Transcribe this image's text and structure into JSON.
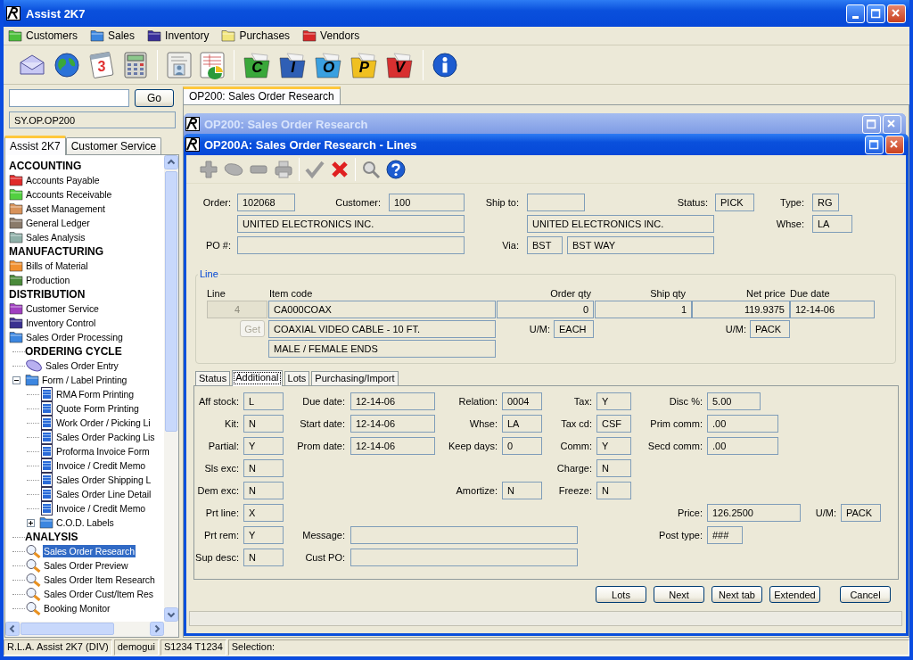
{
  "window": {
    "title": "Assist 2K7"
  },
  "menu": [
    {
      "label": "Customers",
      "color": "#4cbf3c"
    },
    {
      "label": "Sales",
      "color": "#3c86e0"
    },
    {
      "label": "Inventory",
      "color": "#3a2f9a"
    },
    {
      "label": "Purchases",
      "color": "#f2e67c"
    },
    {
      "label": "Vendors",
      "color": "#d82828"
    }
  ],
  "toolbar": {
    "calendar_day": "3",
    "folders": [
      {
        "letter": "C",
        "color": "#3aa83a"
      },
      {
        "letter": "I",
        "color": "#2f5fb5"
      },
      {
        "letter": "O",
        "color": "#3aa0e0"
      },
      {
        "letter": "P",
        "color": "#f0c020"
      },
      {
        "letter": "V",
        "color": "#d83030"
      }
    ]
  },
  "quick_search": {
    "button": "Go"
  },
  "program_path": "SY.OP.OP200",
  "nav_tabs": [
    {
      "label": "Assist 2K7",
      "selected": true
    },
    {
      "label": "Customer Service",
      "selected": false
    }
  ],
  "tree": [
    {
      "kind": "heading",
      "label": "ACCOUNTING",
      "selected": false
    },
    {
      "kind": "folder",
      "label": "Accounts Payable",
      "color": "#e02a2a",
      "selected": false
    },
    {
      "kind": "folder",
      "label": "Accounts Receivable",
      "color": "#52d040",
      "selected": false
    },
    {
      "kind": "folder",
      "label": "Asset Management",
      "color": "#d8925a",
      "selected": false
    },
    {
      "kind": "folder",
      "label": "General Ledger",
      "color": "#8a7a6a",
      "selected": false
    },
    {
      "kind": "folder",
      "label": "Sales Analysis",
      "color": "#8fb0a8",
      "selected": false
    },
    {
      "kind": "heading",
      "label": "MANUFACTURING",
      "selected": false
    },
    {
      "kind": "folder",
      "label": "Bills of Material",
      "color": "#f09030",
      "selected": false
    },
    {
      "kind": "folder",
      "label": "Production",
      "color": "#4a8a3a",
      "selected": false
    },
    {
      "kind": "heading",
      "label": "DISTRIBUTION",
      "selected": false
    },
    {
      "kind": "folder",
      "label": "Customer Service",
      "color": "#a040c0",
      "selected": false
    },
    {
      "kind": "folder",
      "label": "Inventory Control",
      "color": "#3a3090",
      "selected": false
    },
    {
      "kind": "folder",
      "label": "Sales Order Processing",
      "color": "#3c86e0",
      "selected": false,
      "children": [
        {
          "kind": "heading",
          "label": "ORDERING CYCLE",
          "selected": false
        },
        {
          "kind": "entry",
          "label": "Sales Order Entry",
          "selected": false
        },
        {
          "kind": "folder",
          "label": "Form / Label Printing",
          "color": "#3c86e0",
          "selected": false,
          "expanded": true,
          "children": [
            {
              "kind": "form",
              "label": "RMA Form Printing",
              "selected": false
            },
            {
              "kind": "form",
              "label": "Quote Form Printing",
              "selected": false
            },
            {
              "kind": "form",
              "label": "Work Order / Picking Li",
              "selected": false
            },
            {
              "kind": "form",
              "label": "Sales Order Packing Lis",
              "selected": false
            },
            {
              "kind": "form",
              "label": "Proforma Invoice Form",
              "selected": false
            },
            {
              "kind": "form",
              "label": "Invoice / Credit Memo",
              "selected": false
            },
            {
              "kind": "form",
              "label": "Sales Order Shipping L",
              "selected": false
            },
            {
              "kind": "form",
              "label": "Sales Order Line Detail",
              "selected": false
            },
            {
              "kind": "form",
              "label": "Invoice / Credit Memo",
              "selected": false
            },
            {
              "kind": "folder",
              "label": "C.O.D. Labels",
              "color": "#3c86e0",
              "selected": false,
              "expanded": false
            }
          ]
        },
        {
          "kind": "heading",
          "label": "ANALYSIS",
          "selected": false
        },
        {
          "kind": "inquiry",
          "label": "Sales Order Research",
          "selected": true
        },
        {
          "kind": "inquiry",
          "label": "Sales Order Preview",
          "selected": false
        },
        {
          "kind": "inquiry",
          "label": "Sales Order Item Research",
          "selected": false
        },
        {
          "kind": "inquiry",
          "label": "Sales Order Cust/Item Res",
          "selected": false
        },
        {
          "kind": "inquiry",
          "label": "Booking Monitor",
          "selected": false
        }
      ]
    }
  ],
  "document_tab": {
    "label": "OP200: Sales Order Research",
    "selected": true
  },
  "back_window": {
    "title": "OP200: Sales Order Research"
  },
  "lines_window": {
    "title": "OP200A: Sales Order Research - Lines",
    "header_fields": [
      {
        "label": "Order:",
        "value": "102068"
      },
      {
        "label": "Customer:",
        "value": "100"
      },
      {
        "label": "Ship to:"
      },
      {
        "label": "Status:",
        "value": "PICK"
      },
      {
        "label": "Type:",
        "value": "RG"
      },
      {
        "value": "UNITED ELECTRONICS INC."
      },
      {
        "value": "UNITED ELECTRONICS INC."
      },
      {
        "label": "Whse:",
        "value": "LA"
      },
      {
        "label": "PO #:"
      },
      {
        "label": "Via:",
        "value": "BST"
      },
      {
        "value": "BST WAY"
      }
    ],
    "line": {
      "legend": "Line",
      "columns": [
        "Line",
        "Item code",
        "Order qty",
        "Ship qty",
        "Net price",
        "Due date"
      ],
      "values": [
        {
          "value": "4",
          "disabled": true
        },
        {
          "value": "CA000COAX",
          "disabled": false
        },
        {
          "value": "0",
          "disabled": false
        },
        {
          "value": "1",
          "disabled": false
        },
        {
          "value": "119.9375",
          "disabled": false
        },
        {
          "value": "12-14-06",
          "disabled": false
        }
      ],
      "get_button": {
        "label": "Get",
        "disabled": true
      },
      "description": [
        "COAXIAL VIDEO CABLE - 10 FT.",
        "MALE / FEMALE ENDS"
      ],
      "order_um": {
        "label": "U/M:",
        "value": "EACH"
      },
      "price_um": {
        "label": "U/M:",
        "value": "PACK"
      }
    },
    "tabs": [
      {
        "label": "Status",
        "selected": false
      },
      {
        "label": "Additional",
        "selected": true
      },
      {
        "label": "Lots",
        "selected": false
      },
      {
        "label": "Purchasing/Import",
        "selected": false
      }
    ],
    "additional_fields": [
      {
        "label": "Aff stock:",
        "value": "L"
      },
      {
        "label": "Due date:",
        "value": "12-14-06"
      },
      {
        "label": "Relation:",
        "value": "0004"
      },
      {
        "label": "Tax:",
        "value": "Y"
      },
      {
        "label": "Disc %:",
        "value": "5.00"
      },
      {
        "label": "Kit:",
        "value": "N"
      },
      {
        "label": "Start date:",
        "value": "12-14-06"
      },
      {
        "label": "Whse:",
        "value": "LA"
      },
      {
        "label": "Tax cd:",
        "value": "CSF"
      },
      {
        "label": "Prim comm:",
        "value": ".00"
      },
      {
        "label": "Partial:",
        "value": "Y"
      },
      {
        "label": "Prom date:",
        "value": "12-14-06"
      },
      {
        "label": "Keep days:",
        "value": "0"
      },
      {
        "label": "Comm:",
        "value": "Y"
      },
      {
        "label": "Secd comm:",
        "value": ".00"
      },
      {
        "label": "Sls exc:",
        "value": "N"
      },
      {
        "label": "Charge:",
        "value": "N"
      },
      {
        "label": "Dem exc:",
        "value": "N"
      },
      {
        "label": "Amortize:",
        "value": "N"
      },
      {
        "label": "Freeze:",
        "value": "N"
      },
      {
        "label": "Prt line:",
        "value": "X"
      },
      {
        "label": "Price:",
        "value": "126.2500"
      },
      {
        "label": "U/M:",
        "value": "PACK"
      },
      {
        "label": "Prt rem:",
        "value": "Y"
      },
      {
        "label": "Message:"
      },
      {
        "label": "Post type:",
        "value": "###"
      },
      {
        "label": "Sup desc:",
        "value": "N"
      },
      {
        "label": "Cust PO:"
      }
    ],
    "buttons": [
      "Lots",
      "Next",
      "Next tab",
      "Extended",
      "Cancel"
    ]
  },
  "status_bar": [
    "R.L.A. Assist 2K7 (DIV)",
    "demogui",
    "S1234 T1234",
    "Selection:"
  ]
}
